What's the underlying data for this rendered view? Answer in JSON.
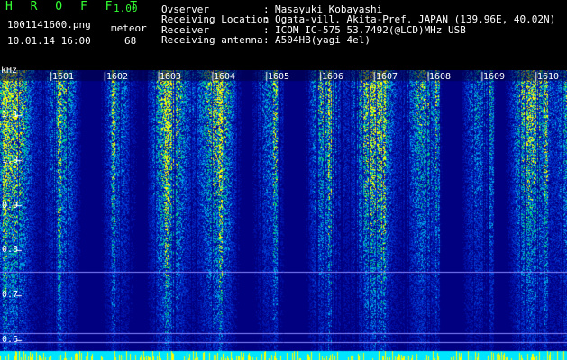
{
  "app": {
    "title": "H R O F F T",
    "version": "1.00",
    "file_name": "1001141600.png",
    "datetime": "10.01.14 16:00",
    "meteor_label": "meteor",
    "meteor_count": "68"
  },
  "info": {
    "rows": [
      {
        "label": "Ovserver",
        "sep": ":",
        "value": "Masayuki Kobayashi"
      },
      {
        "label": "Receiving Location",
        "sep": ":",
        "value": "Ogata-vill. Akita-Pref. JAPAN (139.96E, 40.02N)"
      },
      {
        "label": "Receiver",
        "sep": ":",
        "value": "ICOM IC-575 53.7492(@LCD)MHz USB"
      },
      {
        "label": "Receiving antenna",
        "sep": ":",
        "value": "A504HB(yagi 4el)"
      }
    ]
  },
  "spectrogram": {
    "unit_label": "kHz",
    "y_ticks": [
      "1.1",
      "1.0",
      "0.9",
      "0.8",
      "0.7",
      "0.6"
    ],
    "time_ticks": [
      "1601",
      "1602",
      "1603",
      "1604",
      "1605",
      "1606",
      "1607",
      "1608",
      "1609",
      "1610"
    ],
    "colors": {
      "background": "#000080",
      "low": "#0033cc",
      "mid": "#00cccc",
      "high": "#ffff00",
      "line": "#8888ff",
      "baseline": "#00e5ff"
    }
  }
}
